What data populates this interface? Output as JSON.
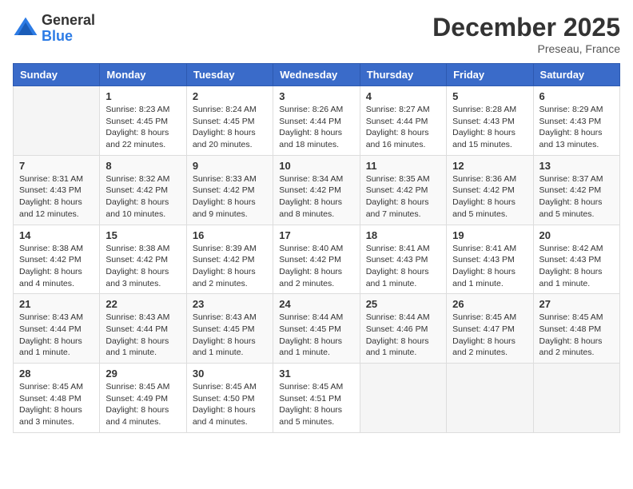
{
  "logo": {
    "general": "General",
    "blue": "Blue"
  },
  "title": "December 2025",
  "location": "Preseau, France",
  "days_header": [
    "Sunday",
    "Monday",
    "Tuesday",
    "Wednesday",
    "Thursday",
    "Friday",
    "Saturday"
  ],
  "weeks": [
    [
      {
        "day": "",
        "info": ""
      },
      {
        "day": "1",
        "info": "Sunrise: 8:23 AM\nSunset: 4:45 PM\nDaylight: 8 hours and 22 minutes."
      },
      {
        "day": "2",
        "info": "Sunrise: 8:24 AM\nSunset: 4:45 PM\nDaylight: 8 hours and 20 minutes."
      },
      {
        "day": "3",
        "info": "Sunrise: 8:26 AM\nSunset: 4:44 PM\nDaylight: 8 hours and 18 minutes."
      },
      {
        "day": "4",
        "info": "Sunrise: 8:27 AM\nSunset: 4:44 PM\nDaylight: 8 hours and 16 minutes."
      },
      {
        "day": "5",
        "info": "Sunrise: 8:28 AM\nSunset: 4:43 PM\nDaylight: 8 hours and 15 minutes."
      },
      {
        "day": "6",
        "info": "Sunrise: 8:29 AM\nSunset: 4:43 PM\nDaylight: 8 hours and 13 minutes."
      }
    ],
    [
      {
        "day": "7",
        "info": "Sunrise: 8:31 AM\nSunset: 4:43 PM\nDaylight: 8 hours and 12 minutes."
      },
      {
        "day": "8",
        "info": "Sunrise: 8:32 AM\nSunset: 4:42 PM\nDaylight: 8 hours and 10 minutes."
      },
      {
        "day": "9",
        "info": "Sunrise: 8:33 AM\nSunset: 4:42 PM\nDaylight: 8 hours and 9 minutes."
      },
      {
        "day": "10",
        "info": "Sunrise: 8:34 AM\nSunset: 4:42 PM\nDaylight: 8 hours and 8 minutes."
      },
      {
        "day": "11",
        "info": "Sunrise: 8:35 AM\nSunset: 4:42 PM\nDaylight: 8 hours and 7 minutes."
      },
      {
        "day": "12",
        "info": "Sunrise: 8:36 AM\nSunset: 4:42 PM\nDaylight: 8 hours and 5 minutes."
      },
      {
        "day": "13",
        "info": "Sunrise: 8:37 AM\nSunset: 4:42 PM\nDaylight: 8 hours and 5 minutes."
      }
    ],
    [
      {
        "day": "14",
        "info": "Sunrise: 8:38 AM\nSunset: 4:42 PM\nDaylight: 8 hours and 4 minutes."
      },
      {
        "day": "15",
        "info": "Sunrise: 8:38 AM\nSunset: 4:42 PM\nDaylight: 8 hours and 3 minutes."
      },
      {
        "day": "16",
        "info": "Sunrise: 8:39 AM\nSunset: 4:42 PM\nDaylight: 8 hours and 2 minutes."
      },
      {
        "day": "17",
        "info": "Sunrise: 8:40 AM\nSunset: 4:42 PM\nDaylight: 8 hours and 2 minutes."
      },
      {
        "day": "18",
        "info": "Sunrise: 8:41 AM\nSunset: 4:43 PM\nDaylight: 8 hours and 1 minute."
      },
      {
        "day": "19",
        "info": "Sunrise: 8:41 AM\nSunset: 4:43 PM\nDaylight: 8 hours and 1 minute."
      },
      {
        "day": "20",
        "info": "Sunrise: 8:42 AM\nSunset: 4:43 PM\nDaylight: 8 hours and 1 minute."
      }
    ],
    [
      {
        "day": "21",
        "info": "Sunrise: 8:43 AM\nSunset: 4:44 PM\nDaylight: 8 hours and 1 minute."
      },
      {
        "day": "22",
        "info": "Sunrise: 8:43 AM\nSunset: 4:44 PM\nDaylight: 8 hours and 1 minute."
      },
      {
        "day": "23",
        "info": "Sunrise: 8:43 AM\nSunset: 4:45 PM\nDaylight: 8 hours and 1 minute."
      },
      {
        "day": "24",
        "info": "Sunrise: 8:44 AM\nSunset: 4:45 PM\nDaylight: 8 hours and 1 minute."
      },
      {
        "day": "25",
        "info": "Sunrise: 8:44 AM\nSunset: 4:46 PM\nDaylight: 8 hours and 1 minute."
      },
      {
        "day": "26",
        "info": "Sunrise: 8:45 AM\nSunset: 4:47 PM\nDaylight: 8 hours and 2 minutes."
      },
      {
        "day": "27",
        "info": "Sunrise: 8:45 AM\nSunset: 4:48 PM\nDaylight: 8 hours and 2 minutes."
      }
    ],
    [
      {
        "day": "28",
        "info": "Sunrise: 8:45 AM\nSunset: 4:48 PM\nDaylight: 8 hours and 3 minutes."
      },
      {
        "day": "29",
        "info": "Sunrise: 8:45 AM\nSunset: 4:49 PM\nDaylight: 8 hours and 4 minutes."
      },
      {
        "day": "30",
        "info": "Sunrise: 8:45 AM\nSunset: 4:50 PM\nDaylight: 8 hours and 4 minutes."
      },
      {
        "day": "31",
        "info": "Sunrise: 8:45 AM\nSunset: 4:51 PM\nDaylight: 8 hours and 5 minutes."
      },
      {
        "day": "",
        "info": ""
      },
      {
        "day": "",
        "info": ""
      },
      {
        "day": "",
        "info": ""
      }
    ]
  ]
}
